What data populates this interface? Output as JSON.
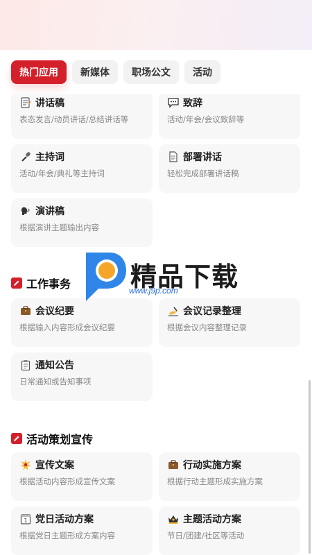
{
  "tabs": [
    {
      "label": "热门应用",
      "active": true
    },
    {
      "label": "新媒体",
      "active": false
    },
    {
      "label": "职场公文",
      "active": false
    },
    {
      "label": "活动",
      "active": false
    }
  ],
  "speech_cards": [
    {
      "title": "讲话稿",
      "desc": "表态发言/动员讲话/总结讲话等",
      "icon": "memo-icon"
    },
    {
      "title": "致辞",
      "desc": "活动/年会/会议致辞等",
      "icon": "speech-bubble-icon"
    },
    {
      "title": "主持词",
      "desc": "活动/年会/典礼等主持词",
      "icon": "microphone-icon"
    },
    {
      "title": "部署讲话",
      "desc": "轻松完成部署讲话稿",
      "icon": "document-icon"
    },
    {
      "title": "演讲稿",
      "desc": "根据演讲主题输出内容",
      "icon": "speaking-head-icon"
    }
  ],
  "sections": {
    "work": {
      "title": "工作事务"
    },
    "activity": {
      "title": "活动策划宣传"
    }
  },
  "work_cards": [
    {
      "title": "会议纪要",
      "desc": "根据输入内容形成会议纪要",
      "icon": "briefcase-icon"
    },
    {
      "title": "会议记录整理",
      "desc": "根据会议内容整理记录",
      "icon": "writing-hand-icon"
    },
    {
      "title": "通知公告",
      "desc": "日常通知或告知事项",
      "icon": "clipboard-icon"
    }
  ],
  "activity_cards": [
    {
      "title": "宣传文案",
      "desc": "根据活动内容形成宣传文案",
      "icon": "sparkle-icon"
    },
    {
      "title": "行动实施方案",
      "desc": "根据行动主题形成实施方案",
      "icon": "briefcase-icon"
    },
    {
      "title": "党日活动方案",
      "desc": "根据党日主题形成方案内容",
      "icon": "calendar-icon"
    },
    {
      "title": "主题活动方案",
      "desc": "节日/团建/社区等活动",
      "icon": "crown-icon"
    }
  ],
  "watermark": {
    "text": "精品下载",
    "url": "www.j9p.com"
  },
  "colors": {
    "accent": "#d4202a",
    "card_bg": "#f7f7f8"
  }
}
